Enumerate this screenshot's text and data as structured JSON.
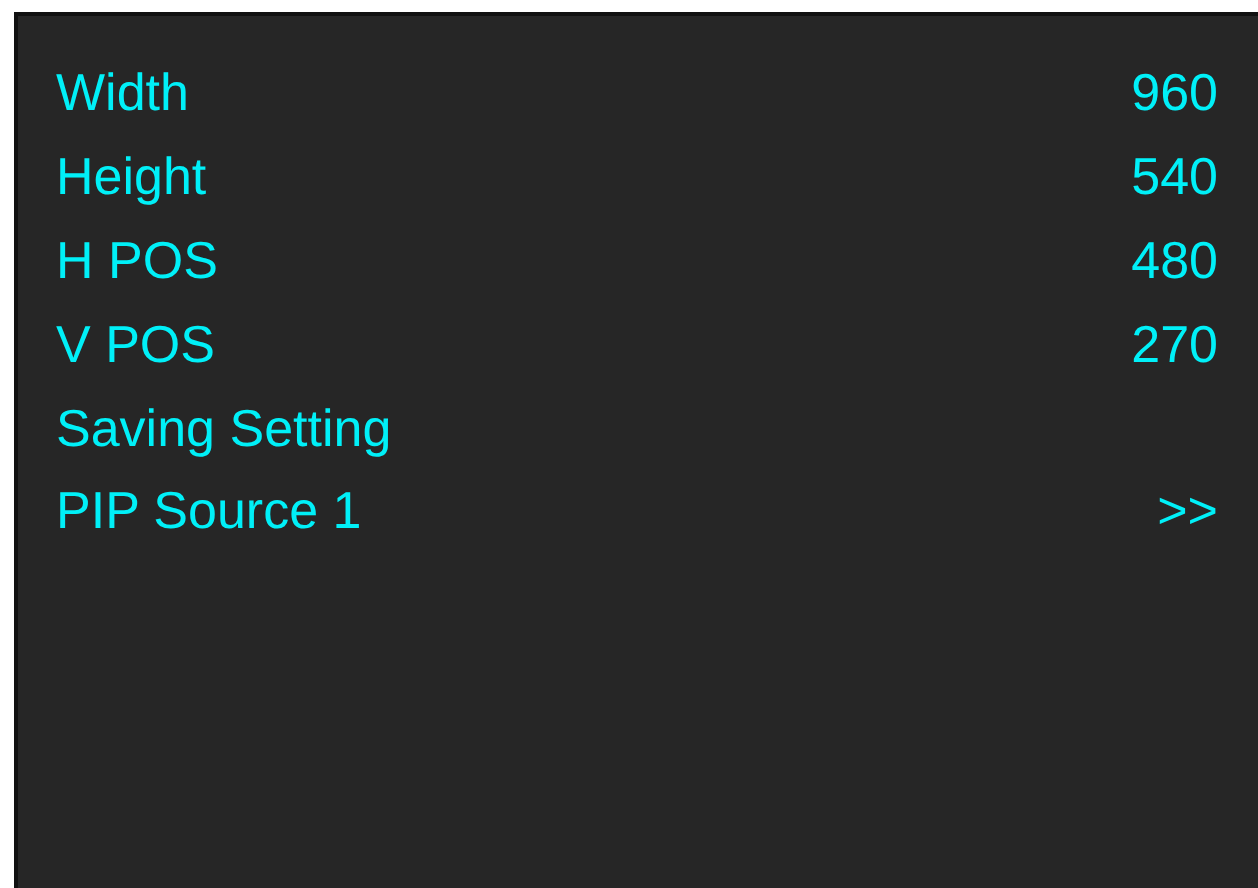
{
  "menu": [
    {
      "label": "Width",
      "value": "960"
    },
    {
      "label": "Height",
      "value": "540"
    },
    {
      "label": "H POS",
      "value": "480"
    },
    {
      "label": "V POS",
      "value": "270"
    },
    {
      "label": "Saving Setting"
    },
    {
      "label": "PIP Source 1",
      "value": ">>"
    }
  ]
}
